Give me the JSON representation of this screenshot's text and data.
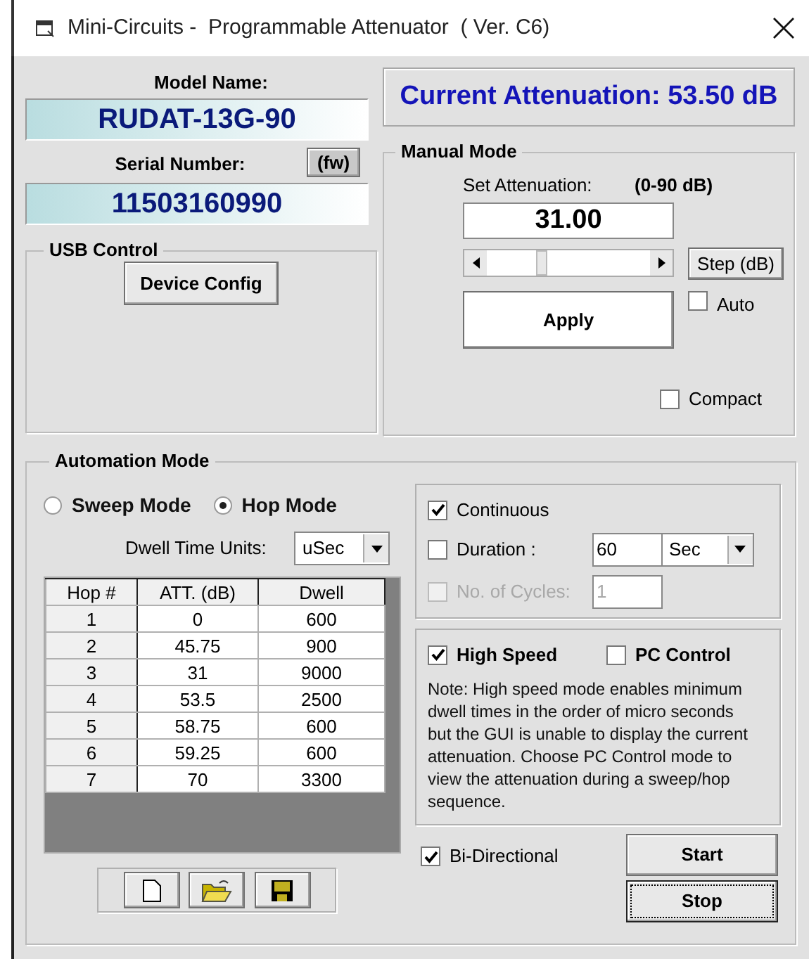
{
  "window": {
    "title": "Mini-Circuits -  Programmable Attenuator  ( Ver. C6)"
  },
  "device": {
    "model_label": "Model Name:",
    "model": "RUDAT-13G-90",
    "serial_label": "Serial Number:",
    "fw_button": "(fw)",
    "serial": "11503160990"
  },
  "usb_control": {
    "title": "USB Control",
    "button": "Device Config"
  },
  "current_attenuation": "Current Attenuation: 53.50 dB",
  "manual_mode": {
    "title": "Manual  Mode",
    "set_label": "Set Attenuation:",
    "range": "(0-90 dB)",
    "value": "31.00",
    "slider": {
      "level": 0.34
    },
    "step_button": "Step (dB)",
    "auto": {
      "label": "Auto",
      "checked": false
    },
    "apply_button": "Apply",
    "compact": {
      "label": "Compact",
      "checked": false
    }
  },
  "automation": {
    "title": "Automation Mode",
    "modes": [
      {
        "label": "Sweep Mode",
        "selected": false
      },
      {
        "label": "Hop Mode",
        "selected": true
      }
    ],
    "dwell_label": "Dwell Time Units:",
    "dwell_unit": "uSec",
    "table": {
      "columns": [
        "Hop #",
        "ATT. (dB)",
        "Dwell"
      ],
      "rows": [
        [
          "1",
          "0",
          "600"
        ],
        [
          "2",
          "45.75",
          "900"
        ],
        [
          "3",
          "31",
          "9000"
        ],
        [
          "4",
          "53.5",
          "2500"
        ],
        [
          "5",
          "58.75",
          "600"
        ],
        [
          "6",
          "59.25",
          "600"
        ],
        [
          "7",
          "70",
          "3300"
        ]
      ]
    },
    "continuous": {
      "label": "Continuous",
      "checked": true
    },
    "duration": {
      "label": "Duration :",
      "checked": false,
      "value": "60",
      "unit": "Sec"
    },
    "cycles": {
      "label": "No. of  Cycles:",
      "checked": false,
      "disabled": true,
      "value": "1"
    },
    "high_speed": {
      "label": "High Speed",
      "checked": true
    },
    "pc_control": {
      "label": "PC Control",
      "checked": false
    },
    "note": "Note: High speed mode enables minimum dwell times in the order of micro seconds  but the GUI is unable to display the current attenuation. Choose PC Control mode to view the attenuation during a sweep/hop sequence.",
    "bi_directional": {
      "label": "Bi-Directional",
      "checked": true
    },
    "buttons": [
      {
        "label": "Start",
        "focused": false
      },
      {
        "label": "Stop",
        "focused": true
      }
    ]
  }
}
